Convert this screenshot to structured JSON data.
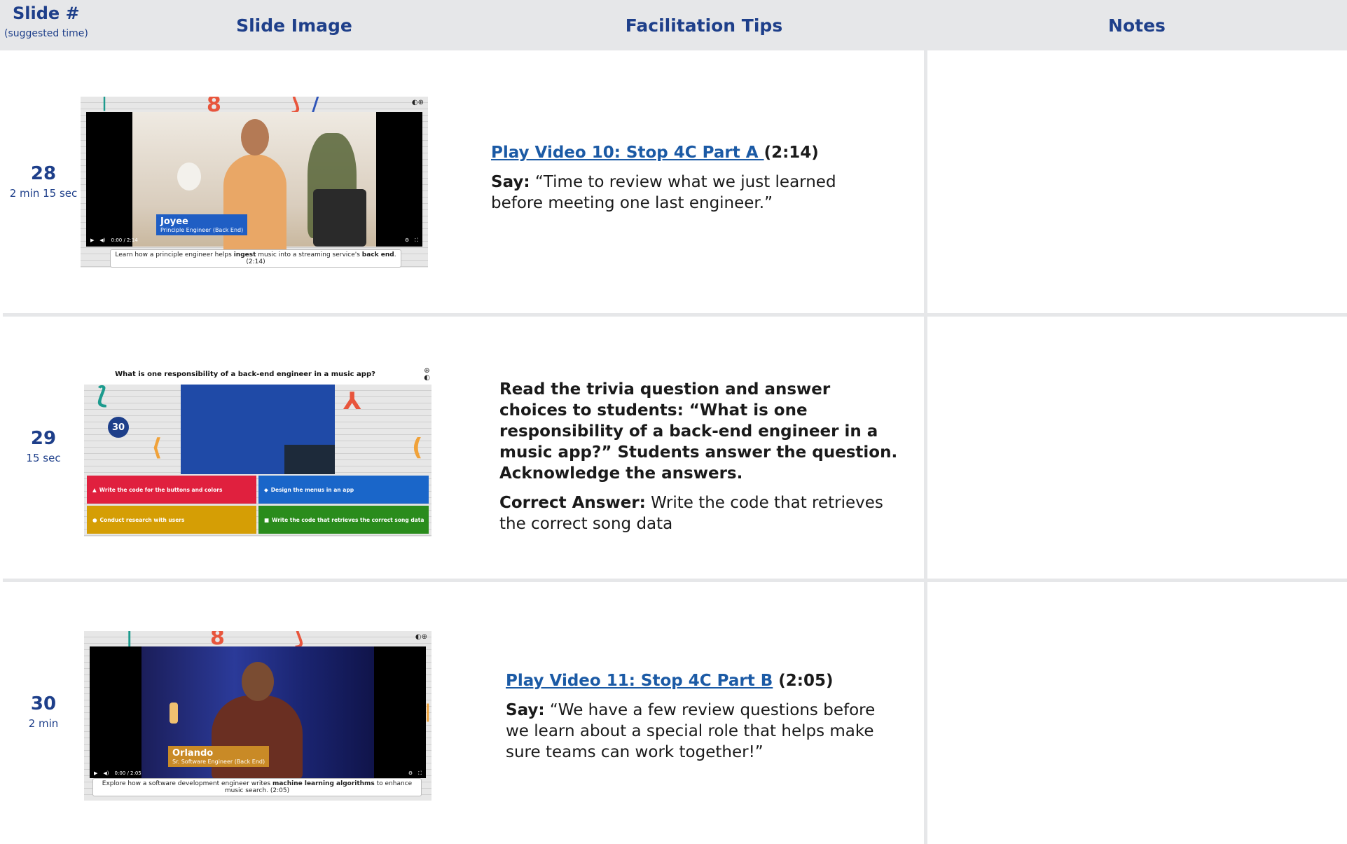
{
  "header": {
    "slide_num_label": "Slide #",
    "suggested_time_label": "(suggested time)",
    "slide_image_label": "Slide Image",
    "facilitation_tips_label": "Facilitation Tips",
    "notes_label": "Notes"
  },
  "rows": [
    {
      "slide_number": "28",
      "time": "2 min 15 sec",
      "thumbnail": {
        "name_tag": "Joyee",
        "name_sub": "Principle Engineer (Back End)",
        "caption_pre": "Learn how a principle engineer helps ",
        "caption_b1": "ingest",
        "caption_mid": " music into a streaming service's ",
        "caption_b2": "back end",
        "caption_post": ". (2:14)",
        "time_display": "0:00 / 2:14"
      },
      "tips": {
        "link_text": "Play Video 10: Stop 4C Part A ",
        "link_duration": "(2:14)",
        "say_label": "Say:",
        "say_text": " “Time to review what we just learned before meeting one last engineer.”"
      }
    },
    {
      "slide_number": "29",
      "time": "15 sec",
      "thumbnail": {
        "question_pre": "What is one responsibility of a ",
        "question_bold": "back-end",
        "question_post": " engineer in a music app?",
        "timer": "30",
        "answers": [
          {
            "shape": "▲",
            "text": "Write the code for the buttons and colors",
            "color": "#e0203e"
          },
          {
            "shape": "◆",
            "text": "Design the menus in an app",
            "color": "#1a66c9"
          },
          {
            "shape": "●",
            "text": "Conduct research with users",
            "color": "#d59e05"
          },
          {
            "shape": "■",
            "text": "Write the code that retrieves the correct song data",
            "color": "#2a8c1c"
          }
        ]
      },
      "tips": {
        "instruction": "Read the trivia question and answer choices to students: “What is one responsibility of a back-end engineer in a music app?” Students answer the question. Acknowledge the answers.",
        "answer_label": "Correct Answer:",
        "answer_text": " Write the code that retrieves the correct song data"
      }
    },
    {
      "slide_number": "30",
      "time": "2 min",
      "thumbnail": {
        "name_tag": "Orlando",
        "name_sub": "Sr. Software Engineer (Back End)",
        "caption_pre": "Explore how a software development engineer writes ",
        "caption_b1": "machine learning algorithms",
        "caption_post": " to enhance music search. (2:05)",
        "time_display": "0:00 / 2:05"
      },
      "tips": {
        "link_text": "Play Video 11: Stop 4C Part B",
        "link_duration": " (2:05)",
        "say_label": "Say:",
        "say_text": " “We have a few review questions before we learn about a special role that helps make sure teams can work together!”"
      }
    }
  ],
  "colors": {
    "header_bg": "#e6e7e9",
    "brand_blue": "#1e3f8a",
    "link_blue": "#1b5aa5"
  }
}
